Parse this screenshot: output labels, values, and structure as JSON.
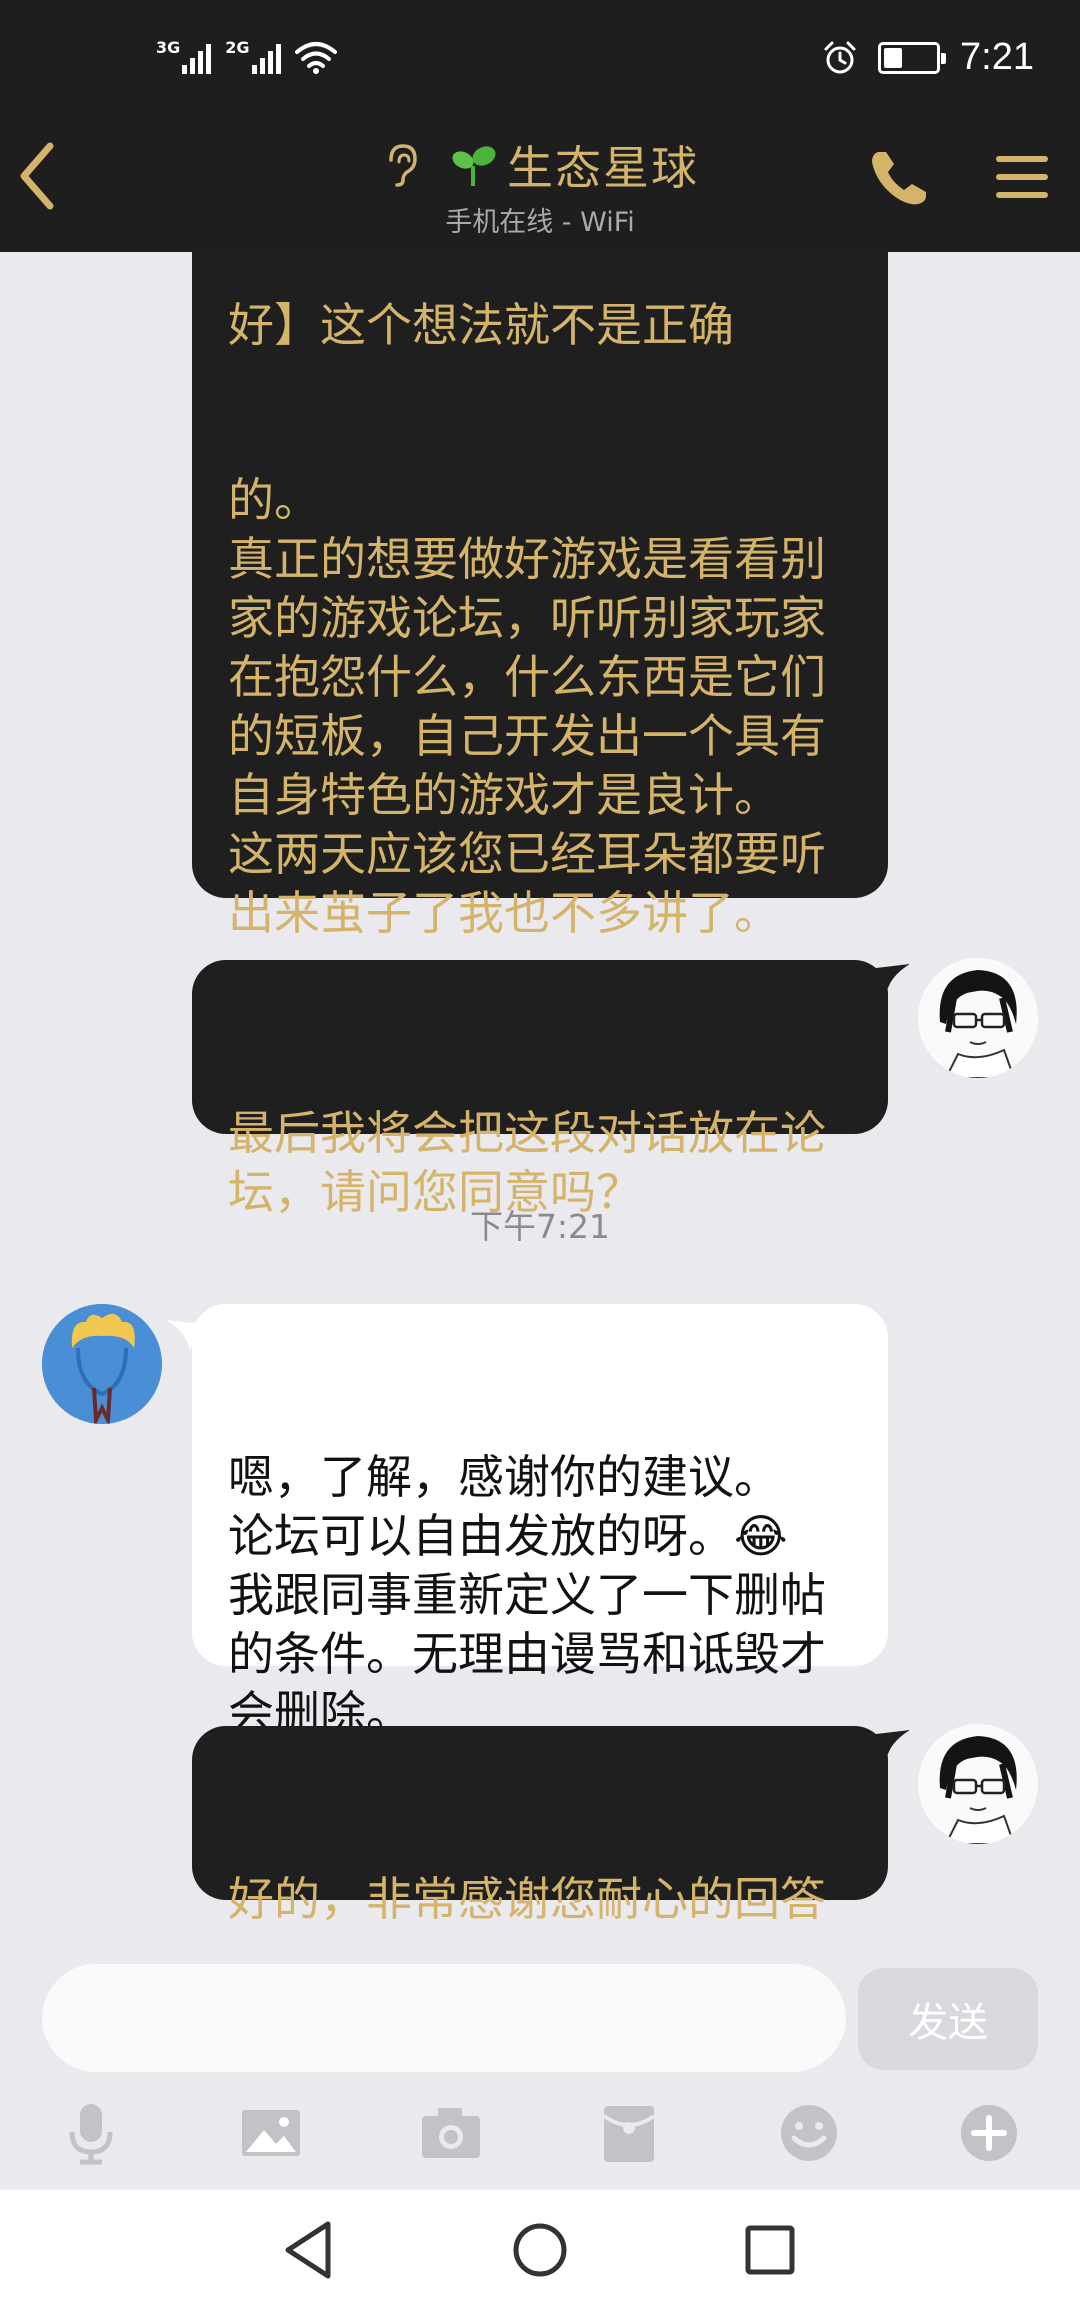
{
  "status_bar": {
    "network_1": "3G",
    "network_2": "2G",
    "time": "7:21",
    "icons": [
      "signal-3g-icon",
      "signal-2g-icon",
      "wifi-icon",
      "alarm-icon",
      "battery-icon"
    ]
  },
  "header": {
    "title": "生态星球",
    "subtitle": "手机在线 - WiFi",
    "icons": [
      "back-icon",
      "ear-icon",
      "sprout-icon",
      "phone-icon",
      "menu-icon"
    ]
  },
  "messages": [
    {
      "sender": "me",
      "partial_top_line": "好】这个想法就不是正确",
      "text": "的。\n真正的想要做好游戏是看看别家的游戏论坛，听听别家玩家在抱怨什么，什么东西是它们的短板，自己开发出一个具有自身特色的游戏才是良计。\n这两天应该您已经耳朵都要听出来茧子了我也不多讲了。"
    },
    {
      "sender": "me",
      "text": "最后我将会把这段对话放在论坛，请问您同意吗？"
    },
    {
      "sender": "other",
      "text": "嗯，了解，感谢你的建议。\n论坛可以自由发放的呀。😂\n我跟同事重新定义了一下删帖的条件。无理由谩骂和诋毁才会删除。"
    },
    {
      "sender": "me",
      "text": "好的，非常感谢您耐心的回答"
    }
  ],
  "timestamp": "下午7:21",
  "composer": {
    "input_value": "",
    "send_label": "发送",
    "tools": [
      "microphone-icon",
      "image-icon",
      "camera-icon",
      "red-packet-icon",
      "emoji-icon",
      "plus-icon"
    ]
  },
  "nav": {
    "buttons": [
      "nav-back-icon",
      "nav-home-icon",
      "nav-recents-icon"
    ]
  },
  "colors": {
    "bar_bg": "#1e1e1e",
    "accent_gold": "#d4b36a",
    "chat_bg": "#e9e9ee",
    "my_bubble": "#1f1f1f",
    "their_bubble": "#ffffff",
    "avatar_blue": "#4a8fd6"
  }
}
